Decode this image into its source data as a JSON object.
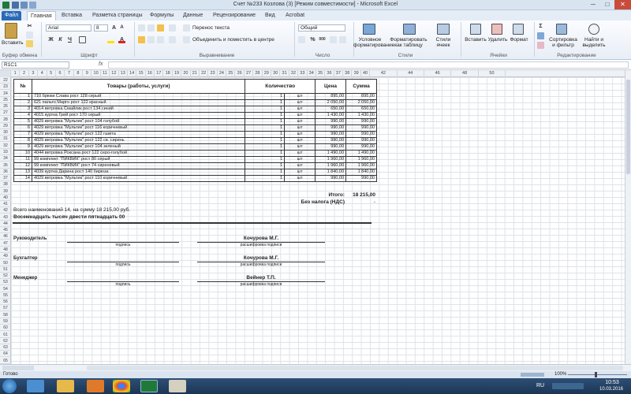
{
  "window": {
    "title": "Счет №233  Козлова (3)  [Режим совместимости]  -  Microsoft Excel",
    "btn_min": "─",
    "btn_max": "□",
    "btn_close": "✕"
  },
  "tabs": [
    "Файл",
    "Главная",
    "Вставка",
    "Разметка страницы",
    "Формулы",
    "Данные",
    "Рецензирование",
    "Вид",
    "Acrobat"
  ],
  "ribbon": {
    "paste": "Вставить",
    "font_name": "Arial",
    "font_size": "8",
    "bold": "Ж",
    "italic": "К",
    "underline": "Ч",
    "wrap": "Перенос текста",
    "merge": "Объединить и поместить в центре",
    "num_format": "Общий",
    "cond_format": "Условное форматирование",
    "format_table": "Форматировать как таблицу",
    "cell_styles": "Стили ячеек",
    "insert": "Вставить",
    "delete": "Удалить",
    "format": "Формат",
    "sort": "Сортировка и фильтр",
    "find": "Найти и выделить",
    "groups": {
      "clipboard": "Буфер обмена",
      "font": "Шрифт",
      "alignment": "Выравнивание",
      "number": "Число",
      "styles": "Стили",
      "cells": "Ячейки",
      "editing": "Редактирование"
    }
  },
  "formula_bar": {
    "name_box": "R1C1",
    "fx": "fx",
    "value": ""
  },
  "col_headers": [
    "1",
    "2",
    "3",
    "4",
    "5",
    "6",
    "7",
    "8",
    "9",
    "10",
    "11",
    "12",
    "13",
    "14",
    "15",
    "16",
    "17",
    "18",
    "19",
    "20",
    "21",
    "22",
    "23",
    "24",
    "25",
    "26",
    "27",
    "28",
    "29",
    "30",
    "31",
    "32",
    "33",
    "34",
    "35",
    "36",
    "37",
    "38",
    "39",
    "40",
    "42",
    "44",
    "46",
    "48",
    "50"
  ],
  "row_headers": [
    "22",
    "23",
    "24",
    "25",
    "26",
    "27",
    "28",
    "29",
    "30",
    "31",
    "32",
    "33",
    "34",
    "35",
    "36",
    "37",
    "38",
    "39",
    "40",
    "41",
    "42",
    "43",
    "44",
    "45",
    "46",
    "47",
    "48",
    "49",
    "50",
    "51",
    "52",
    "53",
    "54",
    "55",
    "56",
    "57",
    "58",
    "59",
    "60",
    "61",
    "62",
    "63",
    "64",
    "65"
  ],
  "invoice": {
    "headers": {
      "no": "№",
      "goods": "Товары (работы, услуги)",
      "qty": "Количество",
      "price": "Цена",
      "sum": "Сумма"
    },
    "rows": [
      [
        "1",
        "710 брюки Слава рост 128 серый",
        "1",
        "шт",
        "895,00",
        "895,00"
      ],
      [
        "2",
        "621 пальто Марго рост 122 красный",
        "1",
        "шт",
        "2 050,00",
        "2 050,00"
      ],
      [
        "3",
        "4014 ветровка Смайлик рост 134 синий",
        "1",
        "шт",
        "650,00",
        "650,00"
      ],
      [
        "4",
        "4015 куртка Грей рост 170 серый",
        "1",
        "шт",
        "1 430,00",
        "1 430,00"
      ],
      [
        "5",
        "4029 ветровка \"Мультик\" рост 104 голубой",
        "1",
        "шт",
        "990,00",
        "990,00"
      ],
      [
        "6",
        "4029 ветровка \"Мультик\" рост 116 коричневый",
        "1",
        "шт",
        "990,00",
        "990,00"
      ],
      [
        "7",
        "4029 ветровка \"Мультик\" рост 122 газета",
        "1",
        "шт",
        "990,00",
        "990,00"
      ],
      [
        "8",
        "4029 ветровка \"Мультик\" рост 122 св. сирень",
        "1",
        "шт",
        "990,00",
        "990,00"
      ],
      [
        "9",
        "4029 ветровка \"Мультик\" рост 104 зеленый",
        "1",
        "шт",
        "990,00",
        "990,00"
      ],
      [
        "10",
        "4044 ветровка Роксана рост 122 серо-голубой",
        "1",
        "шт",
        "1 490,00",
        "1 490,00"
      ],
      [
        "11",
        "99 комплект \"ПИКВИК\" рост 80 серый",
        "1",
        "шт",
        "1 960,00",
        "1 960,00"
      ],
      [
        "12",
        "99 комплект \"ПИКВИК\" рост 74 сиреневый",
        "1",
        "шт",
        "1 960,00",
        "1 960,00"
      ],
      [
        "13",
        "4039 куртка Дарина рост 140 бирюза",
        "1",
        "шт",
        "1 840,00",
        "1 840,00"
      ],
      [
        "14",
        "4029 ветровка \"Мультик\" рост 110 коричневый",
        "1",
        "шт",
        "990,00",
        "990,00"
      ]
    ],
    "total_label": "Итого:",
    "total_value": "18 215,00",
    "vat_label": "Без налога (НДС)",
    "vat_value": "-",
    "summary": "Всего наименований 14, на сумму 18 215,00 руб.",
    "words": "Восемнадцать тысяч двести пятнадцать  00"
  },
  "signatures": [
    {
      "role": "Руководитель",
      "name": "Кочурова М.Г.",
      "left_caption": "подпись",
      "right_caption": "расшифровка подписи"
    },
    {
      "role": "Бухгалтер",
      "name": "Кочурова М.Г.",
      "left_caption": "подпись",
      "right_caption": "расшифровка подписи"
    },
    {
      "role": "Менеджер",
      "name": "Вейнер Т.П.",
      "left_caption": "подпись",
      "right_caption": "расшифровка подписи"
    }
  ],
  "status": {
    "ready": "Готово",
    "zoom": "100%"
  },
  "taskbar": {
    "lang": "RU",
    "time": "10:53",
    "date": "10.03.2016"
  }
}
